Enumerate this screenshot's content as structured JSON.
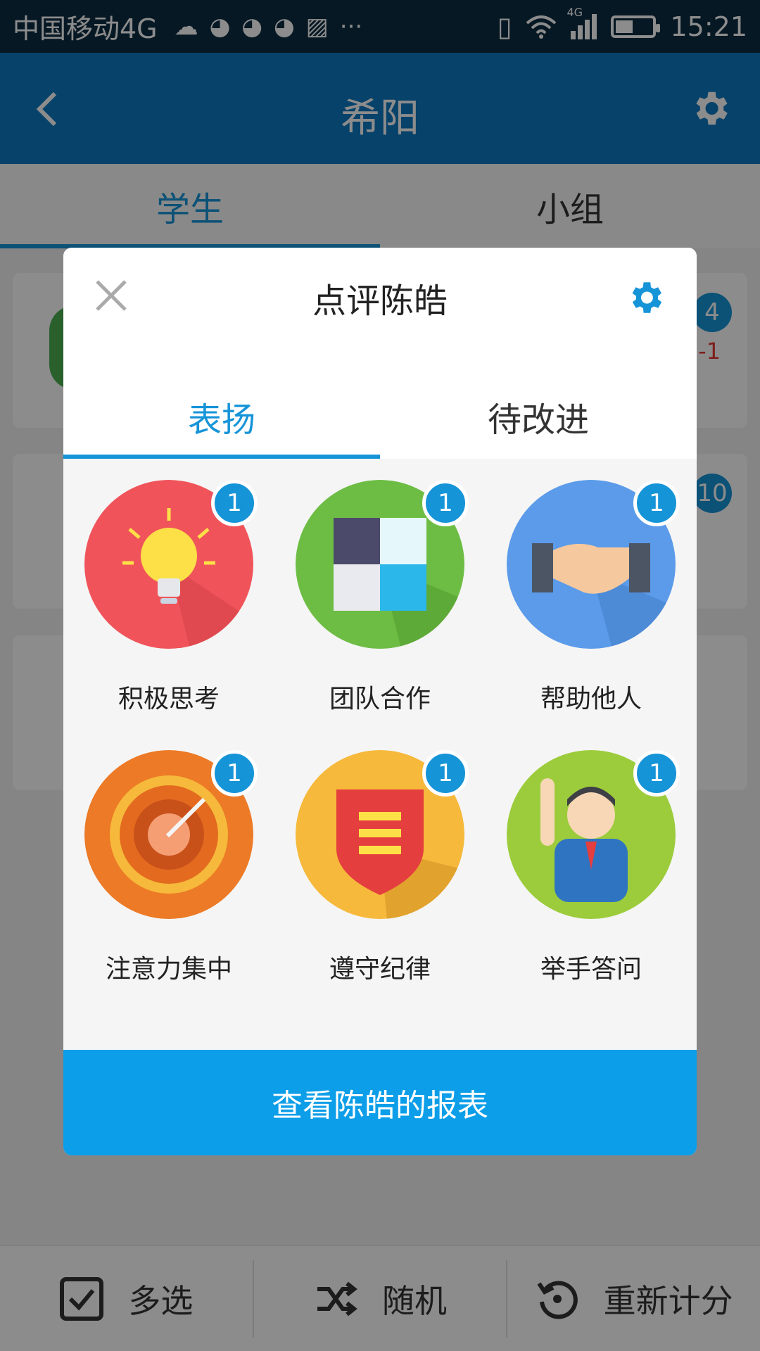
{
  "status_bar": {
    "carrier": "中国移动4G",
    "network_label": "4G",
    "time": "15:21",
    "icons": [
      "cloud-icon",
      "app-icon",
      "app-icon",
      "app-icon",
      "gallery-icon",
      "more-icon",
      "vibrate-icon",
      "wifi-icon",
      "signal-icon",
      "battery-icon"
    ],
    "overflow": "···"
  },
  "app_bar": {
    "title": "希阳",
    "back_icon": "back-icon",
    "settings_icon": "gear-icon"
  },
  "tabs": [
    {
      "label": "学生",
      "active": true
    },
    {
      "label": "小组",
      "active": false
    }
  ],
  "background_cards": [
    {
      "count": "4",
      "delta": "-1"
    },
    {
      "count": "10"
    },
    {}
  ],
  "dialog": {
    "title": "点评陈皓",
    "tabs": [
      {
        "label": "表扬",
        "active": true
      },
      {
        "label": "待改进",
        "active": false
      }
    ],
    "items": [
      {
        "label": "积极思考",
        "badge": "1",
        "icon": "lightbulb-icon",
        "color": "#f0545a"
      },
      {
        "label": "团队合作",
        "badge": "1",
        "icon": "puzzle-icon",
        "color": "#6dbd45"
      },
      {
        "label": "帮助他人",
        "badge": "1",
        "icon": "handshake-icon",
        "color": "#5b9bea"
      },
      {
        "label": "注意力集中",
        "badge": "1",
        "icon": "target-icon",
        "color": "#ec7a26"
      },
      {
        "label": "遵守纪律",
        "badge": "1",
        "icon": "shield-icon",
        "color": "#f6b93b"
      },
      {
        "label": "举手答问",
        "badge": "1",
        "icon": "student-icon",
        "color": "#9ccc3c"
      }
    ],
    "report_button": "查看陈皓的报表"
  },
  "bottom_bar": [
    {
      "label": "多选",
      "icon": "checkbox-icon"
    },
    {
      "label": "随机",
      "icon": "shuffle-icon"
    },
    {
      "label": "重新计分",
      "icon": "reset-icon"
    }
  ],
  "colors": {
    "primary": "#1694d8",
    "app_bar": "#0d78c2",
    "status_bar": "#0b2c43",
    "button": "#0c9ee8"
  }
}
